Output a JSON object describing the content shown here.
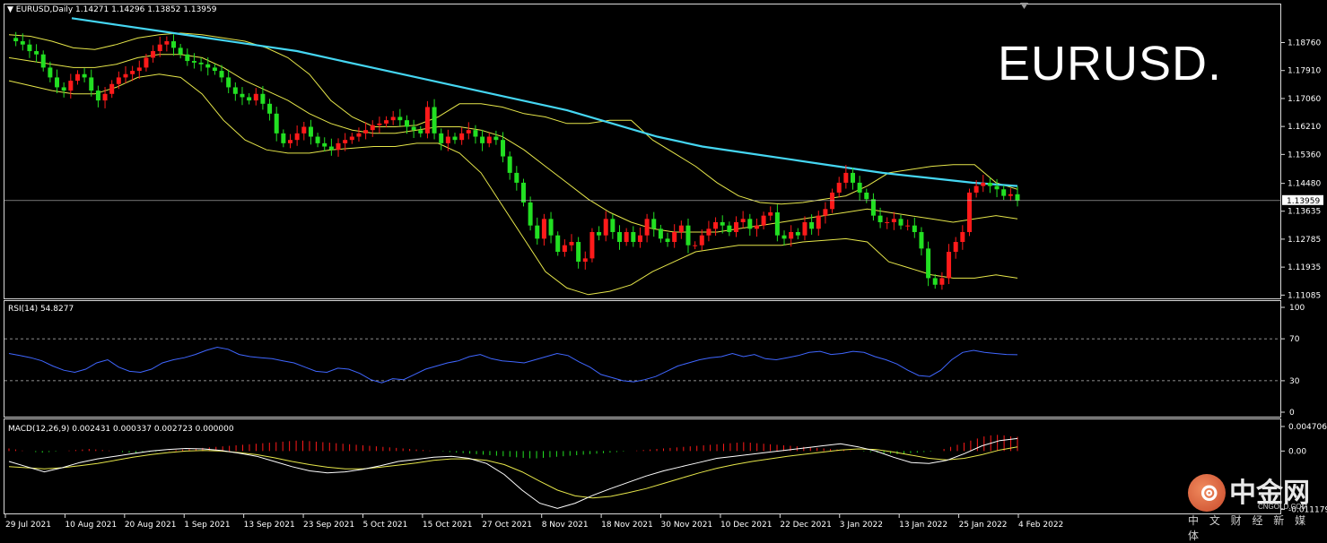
{
  "symbol_header": "▼ EURUSD,Daily  1.14271 1.14296 1.13852 1.13959",
  "big_title": "EURUSD.",
  "current_price_label": "1.13959",
  "rsi_header": "RSI(14) 54.8277",
  "macd_header": "MACD(12,26,9) 0.002431 0.000337 0.002723 0.000000",
  "watermark": {
    "name": "中金网",
    "domain": "CNGOLD.COM",
    "tagline": "中 文 财 经 新 媒 体"
  },
  "colors": {
    "background": "#000000",
    "up_candle": "#ff1a1a",
    "down_candle": "#22e022",
    "bollinger": "#e6e64a",
    "moving_average": "#45d6f2",
    "rsi_line": "#3f66ff",
    "macd_signal": "#e6e64a",
    "macd_main": "#ffffff",
    "grid": "#d9d9d9"
  },
  "icons": {
    "header": "triangle-down-icon",
    "close": "close-icon",
    "logo": "cngold-logo-icon"
  },
  "chart_data": [
    {
      "type": "candlestick",
      "symbol": "EURUSD",
      "timeframe": "Daily",
      "ylim": [
        1.109,
        1.194
      ],
      "y_ticks": [
        "1.18760",
        "1.17910",
        "1.17060",
        "1.16210",
        "1.15360",
        "1.14480",
        "1.13635",
        "1.12785",
        "1.11935",
        "1.11085"
      ],
      "x_ticks": [
        "29 Jul 2021",
        "10 Aug 2021",
        "20 Aug 2021",
        "1 Sep 2021",
        "13 Sep 2021",
        "23 Sep 2021",
        "5 Oct 2021",
        "15 Oct 2021",
        "27 Oct 2021",
        "8 Nov 2021",
        "18 Nov 2021",
        "30 Nov 2021",
        "10 Dec 2021",
        "22 Dec 2021",
        "3 Jan 2022",
        "13 Jan 2022",
        "25 Jan 2022",
        "4 Feb 2022"
      ],
      "current_price": 1.13959,
      "series": [
        {
          "kind": "close",
          "values": [
            1.189,
            1.188,
            1.187,
            1.185,
            1.184,
            1.18,
            1.177,
            1.174,
            1.173,
            1.176,
            1.178,
            1.177,
            1.173,
            1.17,
            1.172,
            1.175,
            1.177,
            1.178,
            1.179,
            1.18,
            1.183,
            1.185,
            1.187,
            1.188,
            1.186,
            1.184,
            1.182,
            1.1815,
            1.181,
            1.18,
            1.179,
            1.177,
            1.174,
            1.172,
            1.171,
            1.17,
            1.172,
            1.169,
            1.166,
            1.16,
            1.157,
            1.158,
            1.16,
            1.162,
            1.159,
            1.157,
            1.156,
            1.155,
            1.157,
            1.158,
            1.159,
            1.16,
            1.161,
            1.1625,
            1.163,
            1.164,
            1.165,
            1.164,
            1.162,
            1.161,
            1.16,
            1.168,
            1.16,
            1.157,
            1.159,
            1.158,
            1.16,
            1.161,
            1.159,
            1.157,
            1.159,
            1.158,
            1.153,
            1.148,
            1.145,
            1.139,
            1.132,
            1.128,
            1.134,
            1.129,
            1.124,
            1.126,
            1.127,
            1.121,
            1.122,
            1.13,
            1.129,
            1.134,
            1.13,
            1.127,
            1.13,
            1.127,
            1.129,
            1.134,
            1.131,
            1.128,
            1.127,
            1.13,
            1.132,
            1.126,
            1.126,
            1.129,
            1.131,
            1.133,
            1.132,
            1.13,
            1.133,
            1.134,
            1.131,
            1.132,
            1.135,
            1.136,
            1.129,
            1.128,
            1.13,
            1.129,
            1.133,
            1.131,
            1.135,
            1.137,
            1.142,
            1.145,
            1.148,
            1.145,
            1.142,
            1.14,
            1.135,
            1.133,
            1.133,
            1.134,
            1.132,
            1.132,
            1.13,
            1.125,
            1.116,
            1.114,
            1.116,
            1.124,
            1.127,
            1.13,
            1.142,
            1.144,
            1.145,
            1.144,
            1.143,
            1.141,
            1.1415,
            1.1396
          ]
        },
        {
          "kind": "bollinger_bands",
          "period": "default",
          "upper": [
            1.19,
            1.1895,
            1.188,
            1.186,
            1.1855,
            1.187,
            1.189,
            1.19,
            1.1905,
            1.19,
            1.189,
            1.188,
            1.186,
            1.183,
            1.178,
            1.17,
            1.165,
            1.162,
            1.162,
            1.1625,
            1.165,
            1.169,
            1.169,
            1.168,
            1.166,
            1.165,
            1.163,
            1.163,
            1.164,
            1.164,
            1.158,
            1.154,
            1.15,
            1.145,
            1.141,
            1.139,
            1.1385,
            1.139,
            1.14,
            1.141,
            1.144,
            1.148,
            1.149,
            1.15,
            1.1505,
            1.1505,
            1.145,
            1.143
          ],
          "middle": [
            1.183,
            1.182,
            1.181,
            1.18,
            1.18,
            1.181,
            1.183,
            1.184,
            1.184,
            1.183,
            1.18,
            1.176,
            1.173,
            1.17,
            1.166,
            1.163,
            1.161,
            1.16,
            1.16,
            1.161,
            1.162,
            1.162,
            1.161,
            1.159,
            1.155,
            1.15,
            1.145,
            1.14,
            1.136,
            1.133,
            1.131,
            1.13,
            1.13,
            1.13,
            1.131,
            1.132,
            1.133,
            1.134,
            1.135,
            1.136,
            1.137,
            1.136,
            1.135,
            1.134,
            1.133,
            1.134,
            1.135,
            1.134
          ],
          "lower": [
            1.176,
            1.1745,
            1.173,
            1.172,
            1.172,
            1.174,
            1.177,
            1.178,
            1.177,
            1.172,
            1.164,
            1.158,
            1.155,
            1.154,
            1.154,
            1.155,
            1.1555,
            1.156,
            1.156,
            1.157,
            1.157,
            1.154,
            1.148,
            1.138,
            1.128,
            1.118,
            1.113,
            1.111,
            1.112,
            1.114,
            1.118,
            1.121,
            1.124,
            1.125,
            1.126,
            1.126,
            1.126,
            1.127,
            1.1275,
            1.128,
            1.127,
            1.121,
            1.119,
            1.117,
            1.116,
            1.116,
            1.117,
            1.116
          ]
        },
        {
          "kind": "moving_average",
          "values": [
            1.195,
            1.193,
            1.191,
            1.189,
            1.187,
            1.185,
            1.182,
            1.179,
            1.176,
            1.173,
            1.17,
            1.167,
            1.163,
            1.159,
            1.156,
            1.154,
            1.152,
            1.15,
            1.148,
            1.1465,
            1.145,
            1.144
          ]
        }
      ]
    },
    {
      "type": "line",
      "name": "RSI(14)",
      "ylim": [
        0,
        100
      ],
      "y_ticks": [
        "100",
        "70",
        "30",
        "0"
      ],
      "levels": [
        70,
        30
      ],
      "values": [
        56,
        54,
        52,
        49,
        44,
        40,
        38,
        41,
        47,
        50,
        43,
        39,
        38,
        41,
        47,
        50,
        52,
        55,
        59,
        62,
        60,
        55,
        53,
        52,
        51,
        49,
        47,
        43,
        39,
        38,
        42,
        41,
        37,
        31,
        28,
        32,
        31,
        36,
        41,
        44,
        47,
        49,
        53,
        55,
        51,
        49,
        48,
        47,
        50,
        53,
        56,
        54,
        48,
        43,
        36,
        33,
        30,
        29,
        31,
        34,
        39,
        44,
        47,
        50,
        52,
        53,
        56,
        53,
        55,
        51,
        50,
        52,
        54,
        57,
        58,
        55,
        56,
        58,
        57,
        53,
        50,
        46,
        40,
        35,
        34,
        40,
        50,
        57,
        59,
        57,
        56,
        55,
        54.8
      ]
    },
    {
      "type": "bar",
      "name": "MACD(12,26,9)",
      "ylim": [
        -0.01179,
        0.0047
      ],
      "y_ticks": [
        "0.004706",
        "0.00",
        "-0.011179"
      ],
      "main": [
        -0.002,
        -0.003,
        -0.004,
        -0.0032,
        -0.0022,
        -0.0015,
        -0.001,
        -0.0005,
        0.0,
        0.0003,
        0.0005,
        0.0004,
        0.0001,
        -0.0004,
        -0.001,
        -0.002,
        -0.003,
        -0.0038,
        -0.0042,
        -0.004,
        -0.0035,
        -0.0028,
        -0.002,
        -0.0016,
        -0.0012,
        -0.001,
        -0.0014,
        -0.0024,
        -0.0045,
        -0.0075,
        -0.01,
        -0.011,
        -0.01,
        -0.0085,
        -0.0072,
        -0.006,
        -0.0048,
        -0.0038,
        -0.003,
        -0.0022,
        -0.0014,
        -0.001,
        -0.0006,
        -0.0002,
        0.0002,
        0.0006,
        0.001,
        0.0014,
        0.0008,
        0.0,
        -0.0012,
        -0.0022,
        -0.0024,
        -0.0018,
        -0.0005,
        0.001,
        0.002,
        0.0024
      ],
      "signal": [
        -0.003,
        -0.0032,
        -0.0034,
        -0.0032,
        -0.0028,
        -0.0024,
        -0.0018,
        -0.0012,
        -0.0007,
        -0.0003,
        0.0,
        0.0001,
        0.0,
        -0.0003,
        -0.0007,
        -0.0013,
        -0.002,
        -0.0026,
        -0.0031,
        -0.0034,
        -0.0034,
        -0.0031,
        -0.0027,
        -0.0023,
        -0.0018,
        -0.0015,
        -0.0015,
        -0.0018,
        -0.0026,
        -0.004,
        -0.0058,
        -0.0075,
        -0.0086,
        -0.009,
        -0.0087,
        -0.008,
        -0.0072,
        -0.0062,
        -0.0052,
        -0.0042,
        -0.0033,
        -0.0026,
        -0.002,
        -0.0015,
        -0.001,
        -0.0006,
        -0.0002,
        0.0002,
        0.0004,
        0.0003,
        -0.0002,
        -0.0008,
        -0.0014,
        -0.0017,
        -0.0014,
        -0.0007,
        0.0002,
        0.0008
      ],
      "histogram": [
        0.0005,
        0.0003,
        0.0001,
        0.0,
        -0.0002,
        -0.0003,
        -0.0002,
        -0.0001,
        0.0,
        0.0001,
        0.0002,
        0.0003,
        0.0004,
        0.0003,
        0.0002,
        0.0001,
        0.0,
        -0.0002,
        -0.0003,
        -0.0004,
        -0.0003,
        -0.0002,
        -0.0001,
        0.0,
        0.0001,
        0.0002,
        0.0003,
        0.0004,
        0.0005,
        0.0006,
        0.0007,
        0.0008,
        0.0009,
        0.001,
        0.0011,
        0.0012,
        0.0013,
        0.0014,
        0.0015,
        0.0016,
        0.0017,
        0.0018,
        0.0019,
        0.002,
        0.002,
        0.0019,
        0.0018,
        0.0017,
        0.0016,
        0.0015,
        0.0014,
        0.0013,
        0.0012,
        0.0011,
        0.001,
        0.0009,
        0.0008,
        0.0007,
        0.0006,
        0.0005,
        0.0004,
        0.0003,
        0.0002,
        0.0001,
        0.0,
        -0.0001,
        -0.0002,
        -0.0003,
        -0.0004,
        -0.0005,
        -0.0006,
        -0.0007,
        -0.0008,
        -0.0009,
        -0.001,
        -0.0011,
        -0.0012,
        -0.0013,
        -0.0014,
        -0.0014,
        -0.0013,
        -0.0012,
        -0.0011,
        -0.001,
        -0.0009,
        -0.0008,
        -0.0007,
        -0.0006,
        -0.0005,
        -0.0004,
        -0.0003,
        -0.0002,
        -0.0001,
        0.0,
        0.0001,
        0.0002,
        0.0003,
        0.0004,
        0.0005,
        0.0006,
        0.0007,
        0.0008,
        0.0009,
        0.001,
        0.0011,
        0.0012,
        0.0013,
        0.0014,
        0.0015,
        0.0016,
        0.0017,
        0.0016,
        0.0015,
        0.0014,
        0.0013,
        0.0012,
        0.0011,
        0.001,
        0.0009,
        0.0008,
        0.0007,
        0.0006,
        0.0005,
        0.0004,
        0.0003,
        0.0002,
        0.0001,
        0.0,
        -0.0001,
        -0.0002,
        -0.0003,
        -0.0004,
        -0.0005,
        -0.0006,
        -0.0005,
        -0.0004,
        -0.0003,
        -0.0002,
        -0.0001,
        0.0,
        0.0004,
        0.0008,
        0.0012,
        0.0016,
        0.002,
        0.0024,
        0.0028,
        0.003,
        0.0031,
        0.003,
        0.0028,
        0.00272
      ]
    }
  ]
}
